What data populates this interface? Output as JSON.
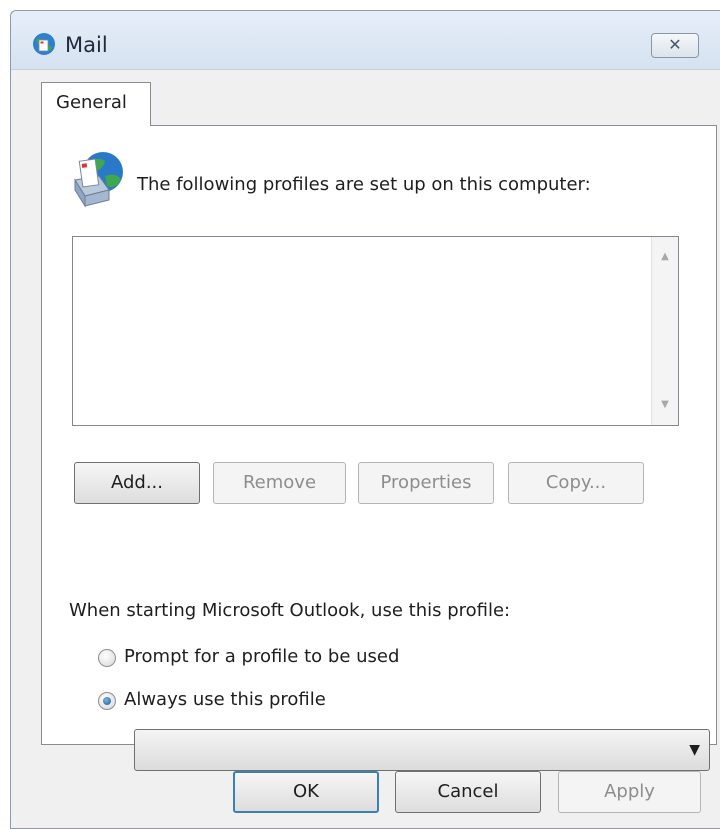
{
  "window": {
    "title": "Mail",
    "close_glyph": "✕"
  },
  "tabs": [
    {
      "label": "General"
    }
  ],
  "general": {
    "heading": "The following profiles are set up on this computer:",
    "profiles": [],
    "buttons": {
      "add": "Add...",
      "remove": "Remove",
      "properties": "Properties",
      "copy": "Copy..."
    },
    "startup_label": "When starting Microsoft Outlook, use this profile:",
    "options": {
      "prompt": "Prompt for a profile to be used",
      "always": "Always use this profile"
    },
    "selected_option": "always",
    "always_profile_value": ""
  },
  "footer": {
    "ok": "OK",
    "cancel": "Cancel",
    "apply": "Apply"
  },
  "colors": {
    "title_bar": "#dbe6f3",
    "focus_border": "#3c7fb1",
    "disabled_text": "#8d8d8d"
  },
  "icons": {
    "app": "mail-globe-icon",
    "profiles": "mail-profiles-icon",
    "close": "close-icon",
    "dropdown": "chevron-down-icon"
  }
}
